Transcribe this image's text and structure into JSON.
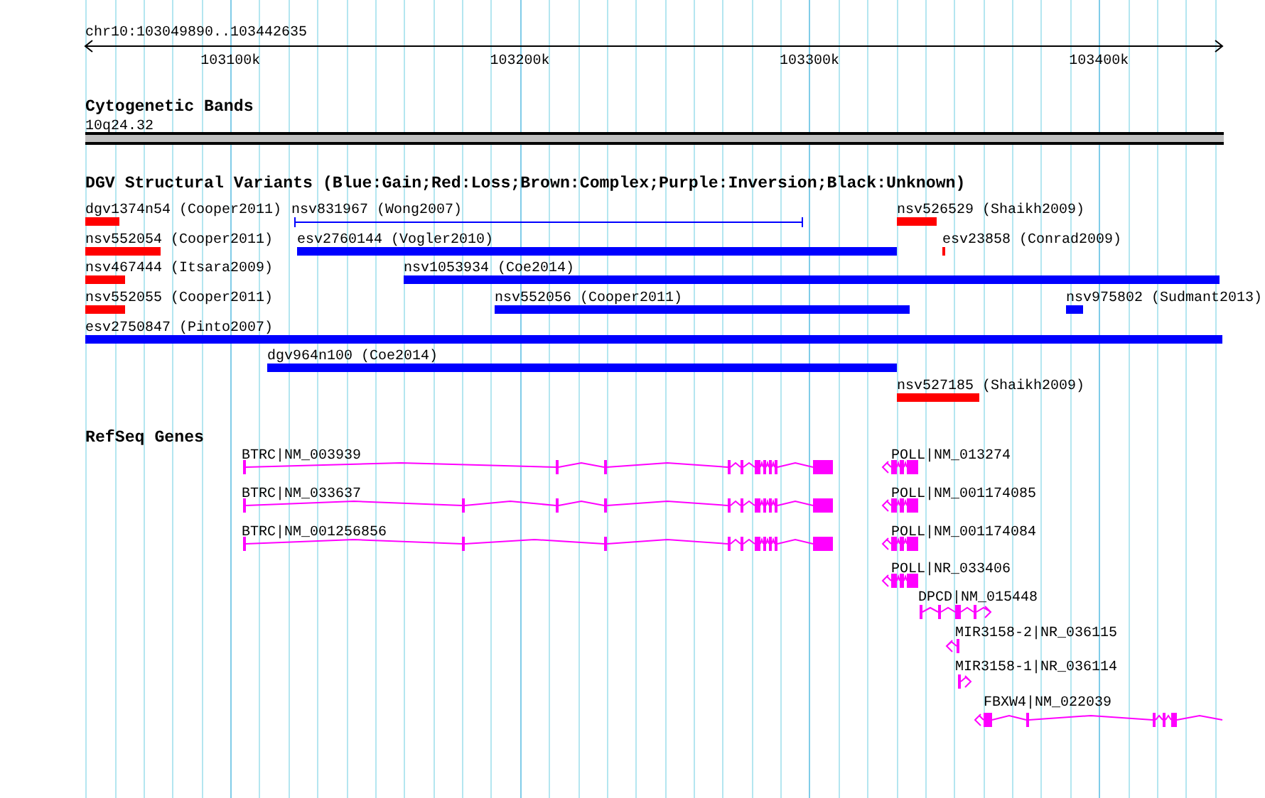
{
  "ruler": {
    "region": "chr10:103049890..103442635",
    "ticks": [
      "103100k",
      "103200k",
      "103300k",
      "103400k"
    ]
  },
  "tracks": [
    {
      "kind": "bands",
      "title": "Cytogenetic Bands",
      "features": [
        {
          "label": "10q24.32"
        }
      ]
    },
    {
      "kind": "variants",
      "title": "DGV Structural Variants (Blue:Gain;Red:Loss;Brown:Complex;Purple:Inversion;Black:Unknown)",
      "features": [
        {
          "label": "dgv1374n54 (Cooper2011)",
          "kind": "bar",
          "color": "#ff0000"
        },
        {
          "label": "nsv831967 (Wong2007)",
          "kind": "line",
          "color": "#0000ff"
        },
        {
          "label": "nsv526529 (Shaikh2009)",
          "kind": "bar",
          "color": "#ff0000"
        },
        {
          "label": "nsv552054 (Cooper2011)",
          "kind": "bar",
          "color": "#ff0000"
        },
        {
          "label": "esv2760144 (Vogler2010)",
          "kind": "bar",
          "color": "#0000ff"
        },
        {
          "label": "esv23858 (Conrad2009)",
          "kind": "bar",
          "color": "#ff0000"
        },
        {
          "label": "nsv467444 (Itsara2009)",
          "kind": "bar",
          "color": "#ff0000"
        },
        {
          "label": "nsv1053934 (Coe2014)",
          "kind": "bar",
          "color": "#0000ff"
        },
        {
          "label": "nsv552055 (Cooper2011)",
          "kind": "bar",
          "color": "#ff0000"
        },
        {
          "label": "nsv552056 (Cooper2011)",
          "kind": "bar",
          "color": "#0000ff"
        },
        {
          "label": "nsv975802 (Sudmant2013)",
          "kind": "bar",
          "color": "#0000ff"
        },
        {
          "label": "esv2750847 (Pinto2007)",
          "kind": "bar",
          "color": "#0000ff"
        },
        {
          "label": "dgv964n100 (Coe2014)",
          "kind": "bar",
          "color": "#0000ff"
        },
        {
          "label": "nsv527185 (Shaikh2009)",
          "kind": "bar",
          "color": "#ff0000"
        }
      ]
    },
    {
      "kind": "genes",
      "title": "RefSeq Genes",
      "features": [
        {
          "label": "BTRC|NM_003939"
        },
        {
          "label": "BTRC|NM_033637"
        },
        {
          "label": "BTRC|NM_001256856"
        },
        {
          "label": "POLL|NM_013274"
        },
        {
          "label": "POLL|NM_001174085"
        },
        {
          "label": "POLL|NM_001174084"
        },
        {
          "label": "POLL|NR_033406"
        },
        {
          "label": "DPCD|NM_015448"
        },
        {
          "label": "MIR3158-2|NR_036115"
        },
        {
          "label": "MIR3158-1|NR_036114"
        },
        {
          "label": "FBXW4|NM_022039"
        }
      ]
    }
  ]
}
